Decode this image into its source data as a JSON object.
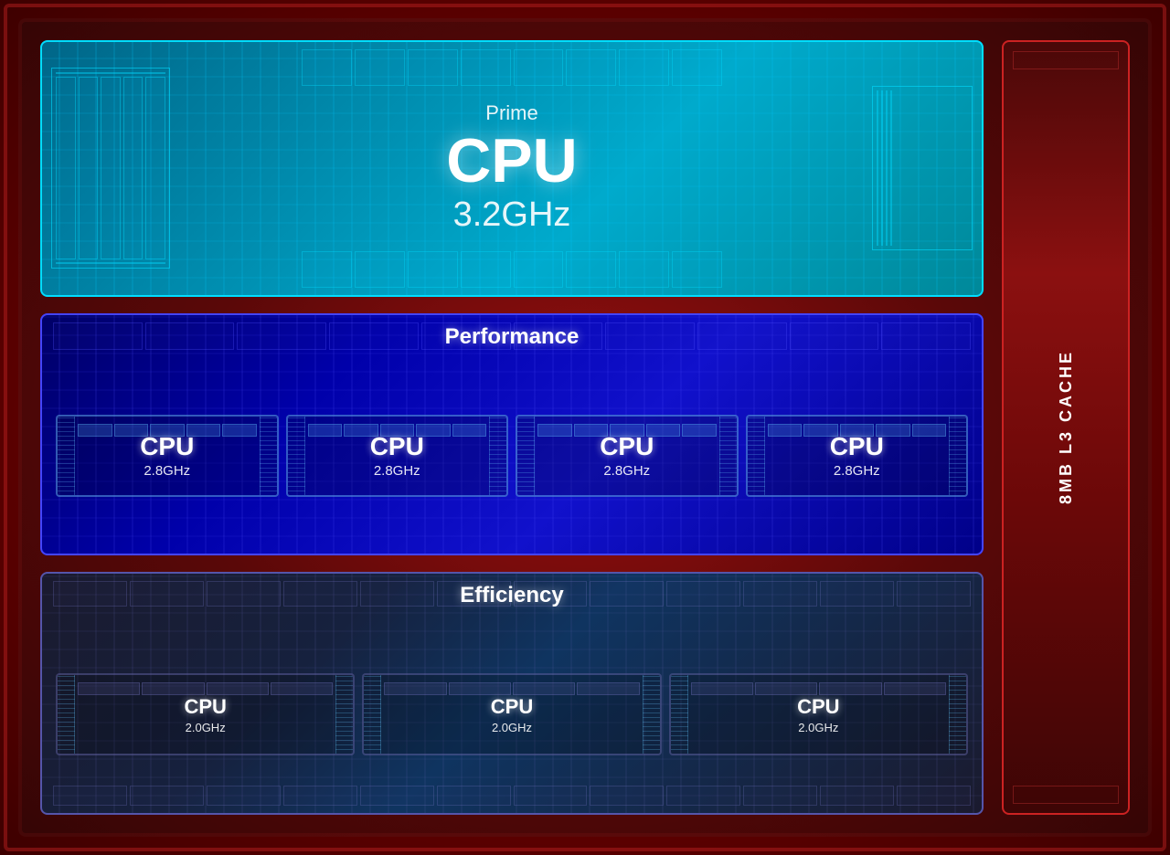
{
  "prime": {
    "title": "Prime",
    "cpu_label": "CPU",
    "frequency": "3.2GHz"
  },
  "performance": {
    "title": "Performance",
    "cpus": [
      {
        "label": "CPU",
        "freq": "2.8GHz"
      },
      {
        "label": "CPU",
        "freq": "2.8GHz"
      },
      {
        "label": "CPU",
        "freq": "2.8GHz"
      },
      {
        "label": "CPU",
        "freq": "2.8GHz"
      }
    ]
  },
  "efficiency": {
    "title": "Efficiency",
    "cpus": [
      {
        "label": "CPU",
        "freq": "2.0GHz"
      },
      {
        "label": "CPU",
        "freq": "2.0GHz"
      },
      {
        "label": "CPU",
        "freq": "2.0GHz"
      }
    ]
  },
  "cache": {
    "label": "8MB L3 CACHE"
  }
}
